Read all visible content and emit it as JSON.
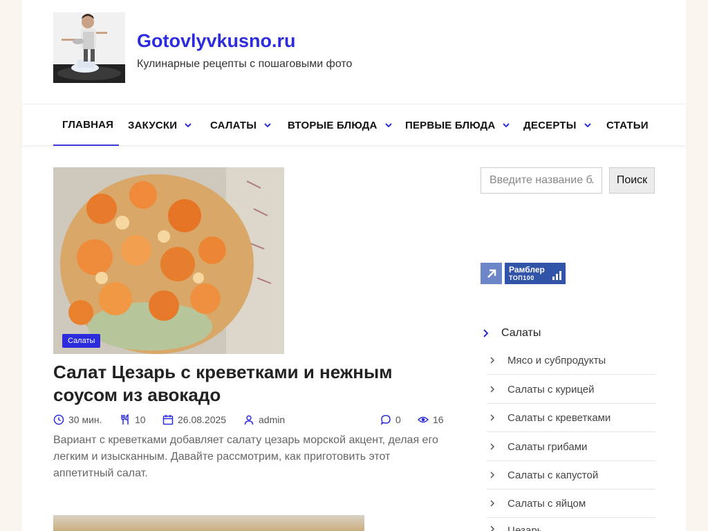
{
  "site": {
    "title": "Gotovlyvkusno.ru",
    "description": "Кулинарные рецепты с пошаговыми фото"
  },
  "nav": {
    "items": [
      {
        "label": "Главная",
        "has_dropdown": false,
        "active": true
      },
      {
        "label": "Закуски",
        "has_dropdown": true
      },
      {
        "label": "Салаты",
        "has_dropdown": true
      },
      {
        "label": "Вторые блюда",
        "has_dropdown": true
      },
      {
        "label": "Первые блюда",
        "has_dropdown": true
      },
      {
        "label": "Десерты",
        "has_dropdown": true
      },
      {
        "label": "Статьи",
        "has_dropdown": false
      }
    ]
  },
  "post": {
    "category": "Салаты",
    "title": "Салат Цезарь с креветками и нежным соусом из авокадо",
    "meta": {
      "time": "30 мин.",
      "servings": "10",
      "date": "26.08.2025",
      "author": "admin",
      "comments": "0",
      "views": "16"
    },
    "excerpt": "Вариант с креветками добавляет салату цезарь морской акцент, делая его легким и изысканным. Давайте рассмотрим, как приготовить этот аппетитный салат."
  },
  "sidebar": {
    "search": {
      "placeholder": "Введите название блюда",
      "button": "Поиск"
    },
    "rambler": {
      "line1": "Рамблер",
      "line2": "ТОП100"
    },
    "category": "Салаты",
    "subcategories": [
      "Мясо и субпродукты",
      "Салаты с курицей",
      "Салаты с креветками",
      "Салаты грибами",
      "Салаты с капустой",
      "Салаты с яйцом",
      "Цезарь"
    ]
  },
  "colors": {
    "accent": "#2c2cdc",
    "background": "#f8f6ee",
    "rambler_blue": "#3254a8"
  }
}
